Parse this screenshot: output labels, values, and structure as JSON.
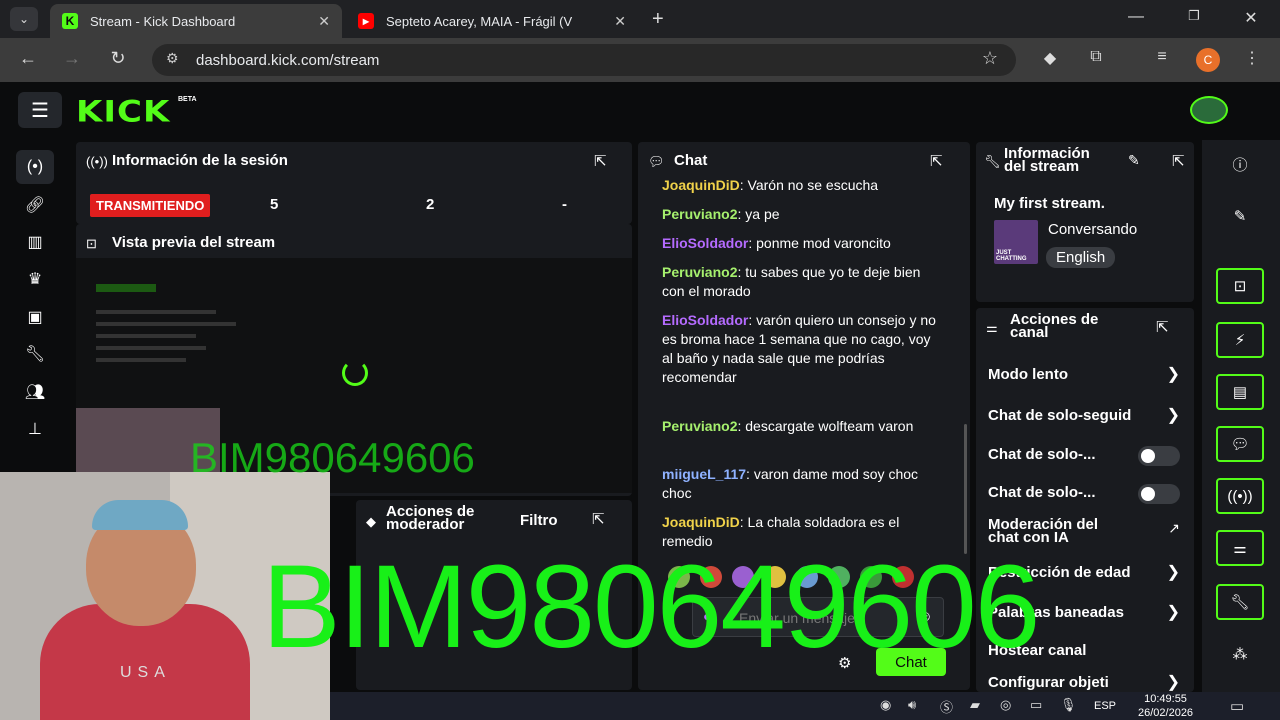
{
  "browser": {
    "tabs": [
      {
        "title": "Stream - Kick Dashboard",
        "favicon": "kick-icon",
        "active": true
      },
      {
        "title": "Septeto Acarey, MAIA - Frágil (V",
        "favicon": "youtube-icon",
        "active": false
      }
    ],
    "url": "dashboard.kick.com/stream",
    "profile_initial": "C"
  },
  "app": {
    "logo": "KICK",
    "beta": "BETA"
  },
  "session_panel": {
    "title": "Información de la sesión",
    "live_label": "TRANSMITIENDO",
    "stats": [
      "5",
      "2",
      "-"
    ]
  },
  "preview_panel": {
    "title": "Vista previa del stream"
  },
  "moderator_panel": {
    "title_line1": "Acciones de",
    "title_line2": "moderador",
    "filter_label": "Filtro"
  },
  "chat": {
    "title": "Chat",
    "messages": [
      {
        "user": "JoaquinDiD",
        "text": ": Varón no se escucha",
        "color": "#f0d24a"
      },
      {
        "user": "Peruviano2",
        "text": ": ya pe",
        "color": "#a6f06e"
      },
      {
        "user": "ElioSoldador",
        "text": ": ponme mod varoncito",
        "color": "#b56bff"
      },
      {
        "user": "Peruviano2",
        "text": ": tu sabes que yo te deje bien con el morado",
        "color": "#a6f06e"
      },
      {
        "user": "ElioSoldador",
        "text": ": varón quiero un consejo y no es broma hace 1 semana que no cago, voy al baño y nada sale que me podrías recomendar",
        "color": "#b56bff"
      },
      {
        "user": "Peruviano2",
        "text": ": descargate wolfteam varon",
        "color": "#a6f06e"
      },
      {
        "user": "miigueL_117",
        "text": ": varon dame mod soy choc choc",
        "color": "#8fb2ff"
      },
      {
        "user": "JoaquinDiD",
        "text": ": La chala soldadora es el remedio",
        "color": "#f0d24a"
      }
    ],
    "input_placeholder": "Enviar un mensaje",
    "send_label": "Chat"
  },
  "stream_info": {
    "title_line1": "Información",
    "title_line2": "del stream",
    "stream_title": "My first stream.",
    "category": "Conversando",
    "language": "English",
    "thumb_text": "JUST CHATTING"
  },
  "channel_actions": {
    "title_line1": "Acciones de",
    "title_line2": "canal",
    "rows": [
      {
        "label": "Modo lento",
        "control": "chevron"
      },
      {
        "label": "Chat de solo-seguid",
        "control": "chevron"
      },
      {
        "label": "Chat de solo-...",
        "control": "toggle"
      },
      {
        "label": "Chat de solo-...",
        "control": "toggle"
      },
      {
        "label_line1": "Moderación del",
        "label_line2": "chat con IA",
        "control": "external"
      },
      {
        "label": "Restricción de edad",
        "control": "chevron"
      },
      {
        "label": "Palabras baneadas",
        "control": "chevron"
      },
      {
        "label": "Hostear canal",
        "control": "none"
      },
      {
        "label": "Configurar objeti",
        "control": "chevron"
      }
    ]
  },
  "overlay": {
    "watermark": "BIM980649606",
    "webcam_text": "USA"
  },
  "taskbar": {
    "lang": "ESP",
    "time": "10:49:55",
    "date": "26/02/2026"
  },
  "colors": {
    "kick_green": "#53fc18",
    "live_red": "#e01e1e",
    "panel_bg": "#191b1f",
    "app_bg": "#0b0c0d"
  }
}
